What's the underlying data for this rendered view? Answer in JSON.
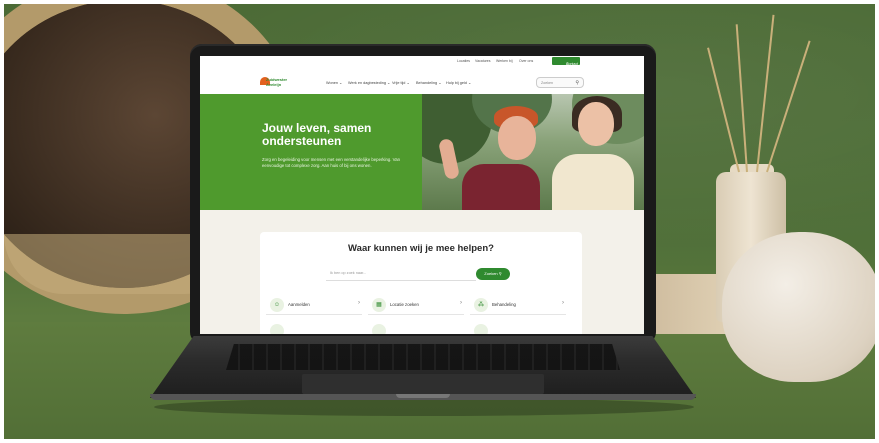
{
  "topbar": {
    "links": [
      "Locaties",
      "Vacatures",
      "Werken bij",
      "Over ons"
    ],
    "contact_label": "Contact",
    "contact_icon": "phone-icon"
  },
  "logo": {
    "line1": "Zuidwester",
    "line2": "Aveleijn"
  },
  "nav": {
    "items": [
      "Wonen",
      "Werk en dagbesteding",
      "Vrije tijd",
      "Behandeling",
      "Hulp bij geld"
    ],
    "search_placeholder": "Zoeken"
  },
  "hero": {
    "title": "Jouw leven, samen ondersteunen",
    "subtitle": "Zorg en begeleiding voor mensen met een verstandelijke beperking. Van eenvoudige tot complexe zorg. Aan huis of bij ons wonen."
  },
  "help": {
    "title": "Waar kunnen wij je mee helpen?",
    "search_placeholder": "Ik ben op zoek naar...",
    "search_button": "Zoeken",
    "tiles": [
      {
        "label": "Aanmelden",
        "icon": "person-icon"
      },
      {
        "label": "Locatie zoeken",
        "icon": "map-icon"
      },
      {
        "label": "Behandeling",
        "icon": "stethoscope-icon"
      }
    ]
  },
  "colors": {
    "brand_green": "#4f9a2d",
    "button_green": "#2f8a2f",
    "logo_orange": "#e2611f"
  }
}
